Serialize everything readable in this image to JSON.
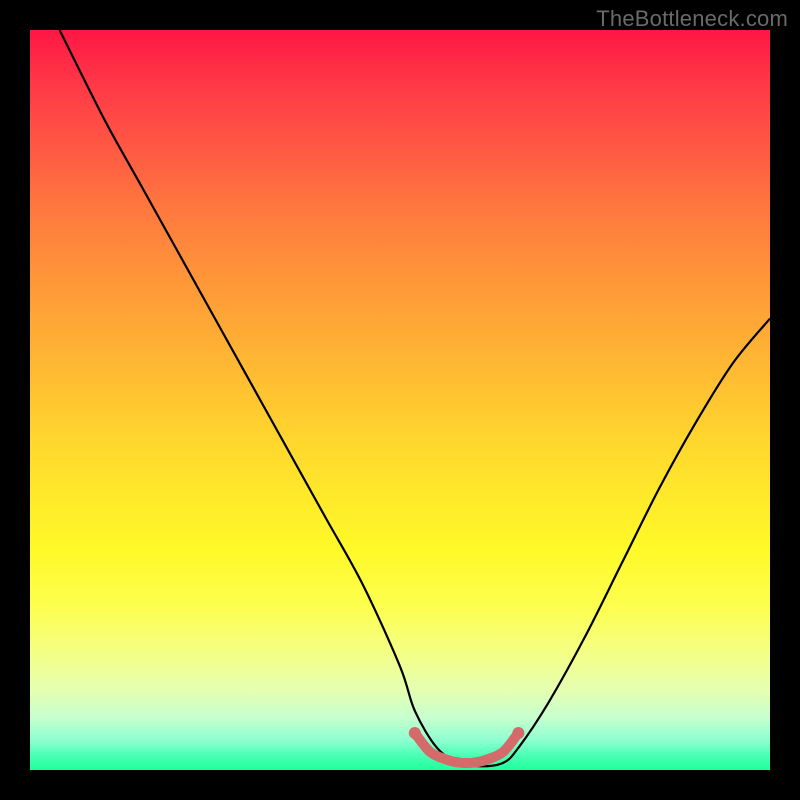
{
  "watermark": "TheBottleneck.com",
  "chart_data": {
    "type": "line",
    "title": "",
    "xlabel": "",
    "ylabel": "",
    "xlim": [
      0,
      100
    ],
    "ylim": [
      0,
      100
    ],
    "series": [
      {
        "name": "bottleneck-curve",
        "x": [
          4,
          10,
          15,
          20,
          25,
          30,
          35,
          40,
          45,
          50,
          52,
          55,
          58,
          61,
          64,
          66,
          70,
          75,
          80,
          85,
          90,
          95,
          100
        ],
        "y": [
          100,
          88,
          79,
          70,
          61,
          52,
          43,
          34,
          25,
          14,
          8,
          3,
          1,
          0.5,
          1,
          3,
          9,
          18,
          28,
          38,
          47,
          55,
          61
        ]
      },
      {
        "name": "optimal-zone-marker",
        "x": [
          52,
          54,
          56,
          58,
          60,
          62,
          64,
          66
        ],
        "y": [
          5,
          2.5,
          1.5,
          1,
          1,
          1.5,
          2.5,
          5
        ]
      }
    ],
    "colors": {
      "curve": "#000000",
      "marker": "#d46a6a"
    }
  }
}
